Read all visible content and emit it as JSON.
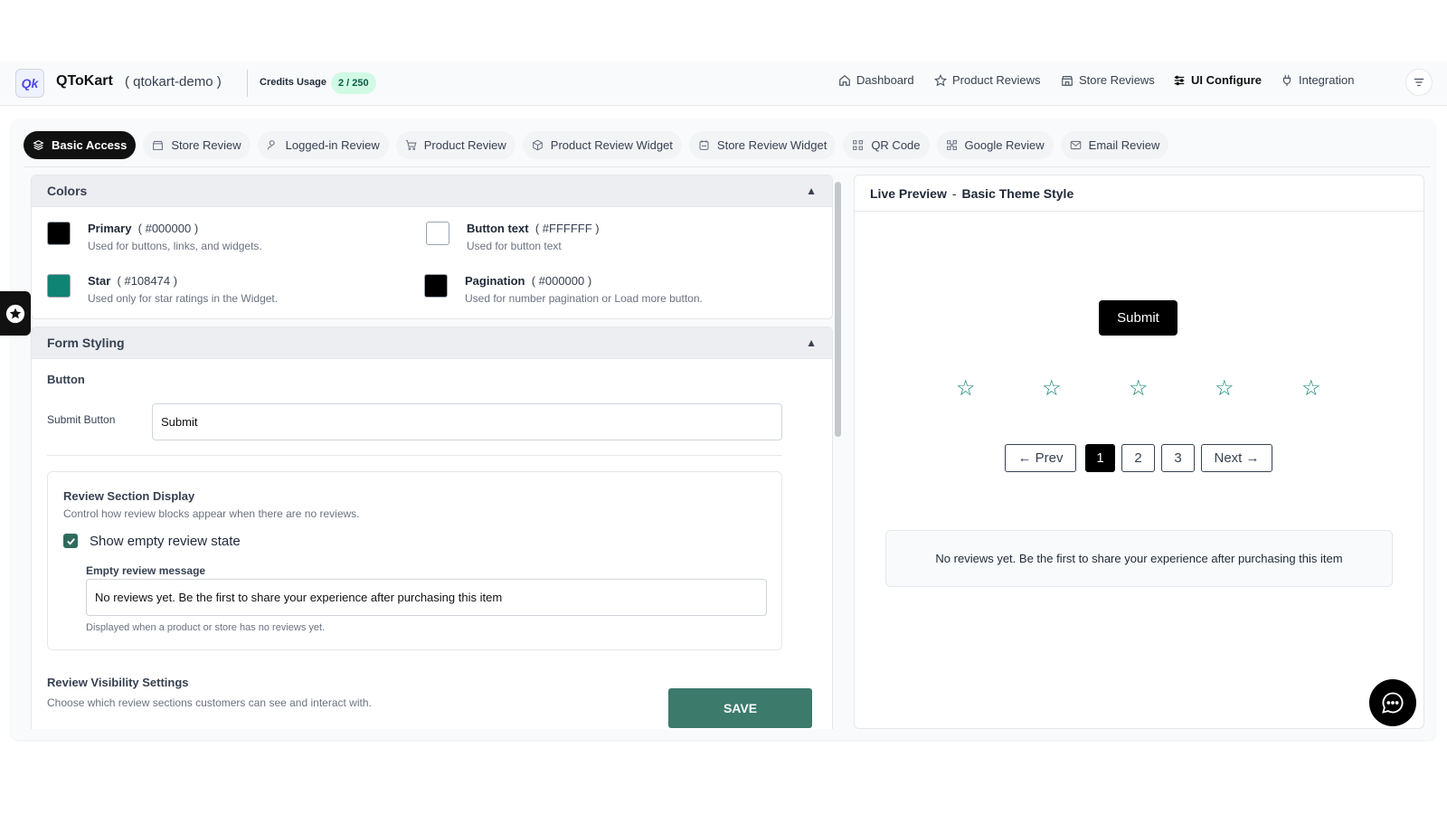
{
  "header": {
    "brand": "QToKart",
    "store": "( qtokart-demo )",
    "credits_label": "Credits Usage",
    "credits_value": "2 / 250",
    "nav": [
      {
        "label": "Dashboard",
        "icon": "home-icon"
      },
      {
        "label": "Product Reviews",
        "icon": "star-icon"
      },
      {
        "label": "Store Reviews",
        "icon": "store-icon"
      },
      {
        "label": "UI Configure",
        "icon": "sliders-icon",
        "active": true
      },
      {
        "label": "Integration",
        "icon": "plug-icon"
      }
    ]
  },
  "tabs": [
    {
      "label": "Basic Access",
      "active": true
    },
    {
      "label": "Store Review"
    },
    {
      "label": "Logged-in Review"
    },
    {
      "label": "Product Review"
    },
    {
      "label": "Product Review Widget"
    },
    {
      "label": "Store Review Widget"
    },
    {
      "label": "QR Code"
    },
    {
      "label": "Google Review"
    },
    {
      "label": "Email Review"
    }
  ],
  "colors": {
    "title": "Colors",
    "items": [
      {
        "name": "Primary",
        "value": "( #000000 )",
        "desc": "Used for buttons, links, and widgets.",
        "hex": "#000000"
      },
      {
        "name": "Button text",
        "value": "( #FFFFFF )",
        "desc": "Used for button text",
        "hex": "#FFFFFF"
      },
      {
        "name": "Star",
        "value": "( #108474 )",
        "desc": "Used only for star ratings in the Widget.",
        "hex": "#108474"
      },
      {
        "name": "Pagination",
        "value": "( #000000 )",
        "desc": "Used for number pagination or Load more button.",
        "hex": "#000000"
      }
    ]
  },
  "form_styling": {
    "title": "Form Styling",
    "button_heading": "Button",
    "submit_label": "Submit Button",
    "submit_value": "Submit",
    "review_section": {
      "title": "Review Section Display",
      "desc": "Control how review blocks appear when there are no reviews.",
      "checkbox_label": "Show empty review state",
      "checked": true,
      "message_label": "Empty review message",
      "message_value": "No reviews yet. Be the first to share your experience after purchasing this item",
      "help": "Displayed when a product or store has no reviews yet."
    },
    "visibility_title": "Review Visibility Settings",
    "visibility_desc": "Choose which review sections customers can see and interact with."
  },
  "save_label": "SAVE",
  "preview": {
    "title": "Live Preview",
    "dash": "-",
    "subtitle": "Basic Theme Style",
    "submit": "Submit",
    "star_glyph": "☆",
    "star_color": "#108474",
    "pagination": {
      "prev": "← Prev",
      "pages": [
        "1",
        "2",
        "3"
      ],
      "next": "Next →",
      "current": "1"
    },
    "empty_message": "No reviews yet. Be the first to share your experience after purchasing this item"
  }
}
